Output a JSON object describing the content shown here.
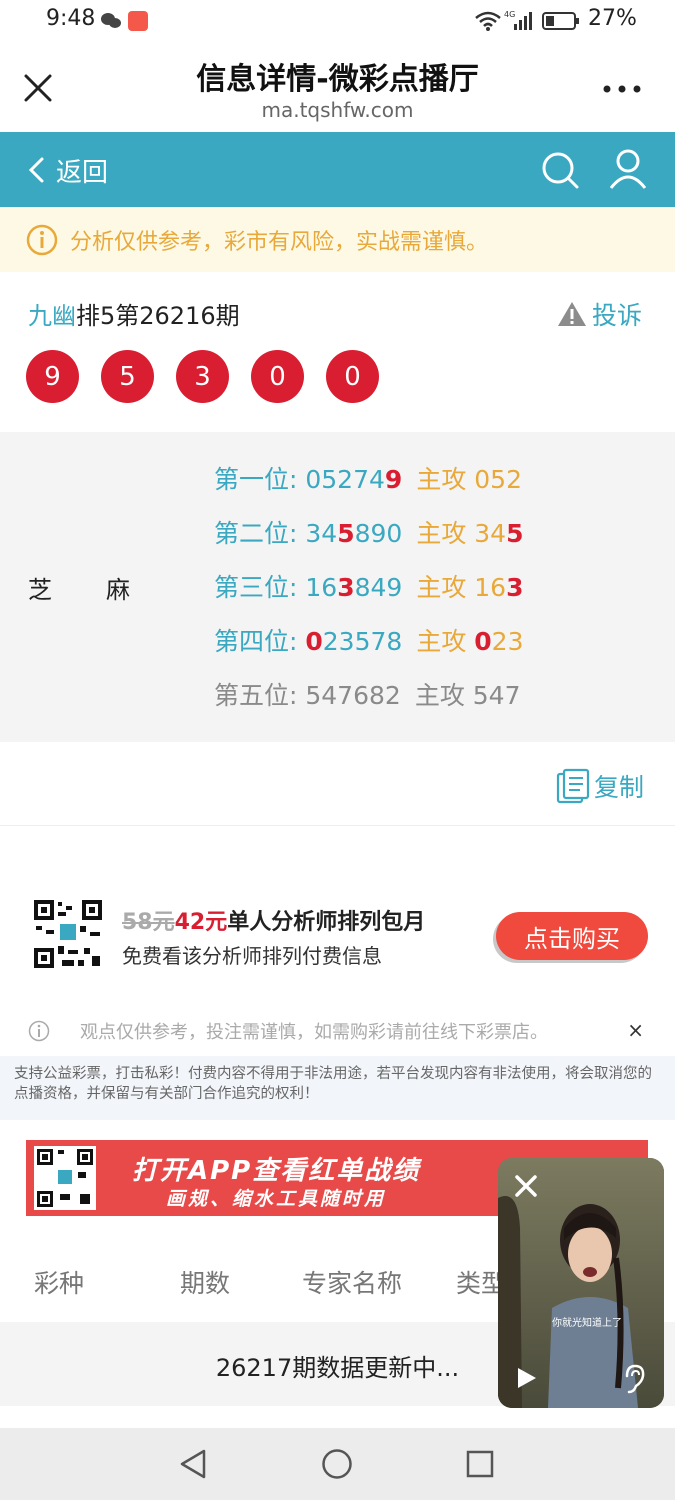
{
  "status_bar": {
    "time": "9:48",
    "battery": "27%",
    "network": "4G"
  },
  "browser": {
    "title": "信息详情-微彩点播厅",
    "url": "ma.tqshfw.com"
  },
  "header": {
    "back_label": "返回"
  },
  "notice": {
    "text": "分析仅供参考，彩市有风险，实战需谨慎。"
  },
  "draw": {
    "prefix": "九幽",
    "rest": "排5第26216期",
    "complaint_label": "投诉",
    "balls": [
      "9",
      "5",
      "3",
      "0",
      "0"
    ]
  },
  "prediction": {
    "name_1": "芝",
    "name_2": "麻",
    "rows": [
      {
        "label": "第一位: ",
        "d1": "05274",
        "d1r": "9",
        "d1b": "",
        "main": "主攻 ",
        "m1": "052",
        "m1r": "",
        "m1b": ""
      },
      {
        "label": "第二位: ",
        "d1": "34",
        "d1r": "5",
        "d1b": "890",
        "main": "主攻 ",
        "m1": "34",
        "m1r": "5",
        "m1b": ""
      },
      {
        "label": "第三位: ",
        "d1": "16",
        "d1r": "3",
        "d1b": "849",
        "main": "主攻 ",
        "m1": "16",
        "m1r": "3",
        "m1b": ""
      },
      {
        "label": "第四位: ",
        "d1": "",
        "d1r": "0",
        "d1b": "23578",
        "main": "主攻 ",
        "m1": "",
        "m1r": "0",
        "m1b": "23"
      },
      {
        "label": "第五位: ",
        "d1": "547682",
        "d1r": "",
        "d1b": "",
        "main": "主攻 ",
        "m1": "547",
        "m1r": "",
        "m1b": ""
      }
    ]
  },
  "copy": {
    "label": "复制"
  },
  "promo": {
    "old_price": "58元",
    "new_price": "42元",
    "title": "单人分析师排列包月",
    "subtitle": "免费看该分析师排列付费信息",
    "buy_label": "点击购买",
    "disclaimer": "观点仅供参考，投注需谨慎，如需购彩请前往线下彩票店。",
    "close": "×"
  },
  "legal": {
    "text": "支持公益彩票，打击私彩！付费内容不得用于非法用途，若平台发现内容有非法使用，将会取消您的点播资格，并保留与有关部门合作追究的权利！"
  },
  "banner": {
    "line1": "打开APP查看红单战绩",
    "line2": "画规、缩水工具随时用"
  },
  "table": {
    "headers": [
      "彩种",
      "期数",
      "专家名称",
      "类型"
    ],
    "status": "26217期数据更新中..."
  },
  "video": {
    "caption": "你就光知道上了"
  },
  "colors": {
    "teal": "#3aa8c1",
    "red_ball": "#d81e30",
    "orange": "#e8a93a",
    "buy_button": "#f0493d"
  }
}
